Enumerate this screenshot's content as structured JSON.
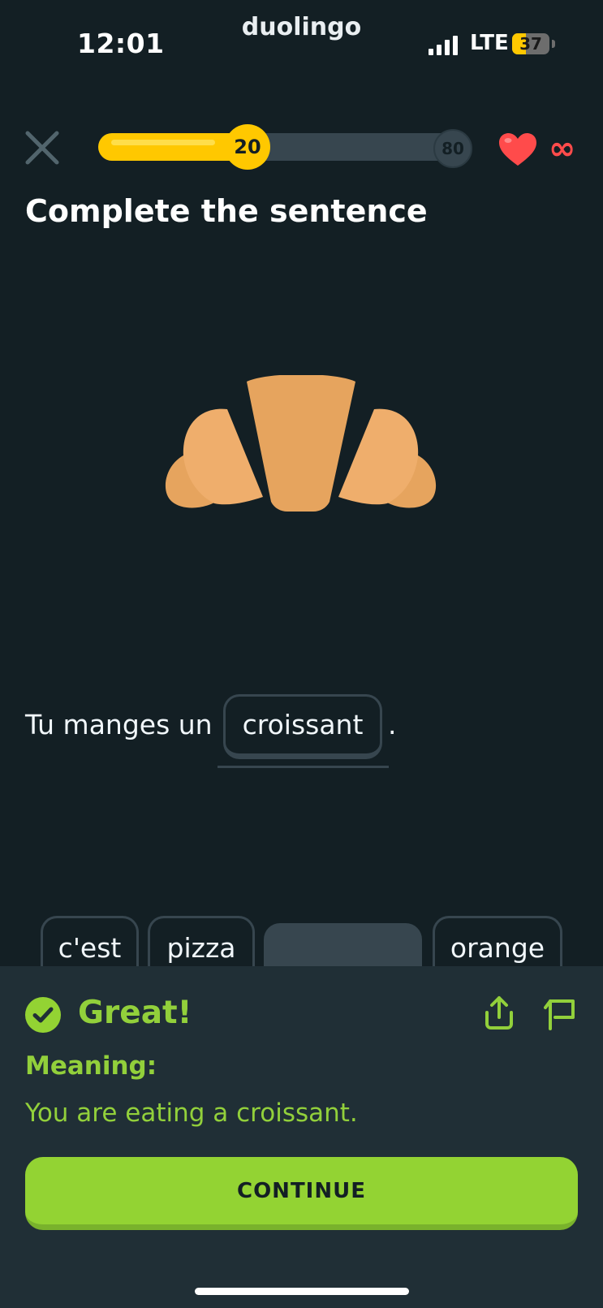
{
  "status_bar": {
    "time": "12:01",
    "brand": "duolingo",
    "network": "LTE",
    "battery": "37",
    "battery_level": 0.37
  },
  "lesson": {
    "progress_value": "20",
    "progress_goal": "80",
    "progress_fraction": 0.4,
    "hearts": "∞",
    "title": "Complete the sentence",
    "image_icon": "croissant-icon"
  },
  "sentence": {
    "before": "Tu manges un",
    "answer": "croissant",
    "after": "."
  },
  "word_bank": {
    "words": [
      "c'est",
      "pizza",
      "croissant",
      "orange"
    ],
    "used_index": 2
  },
  "feedback": {
    "status": "Great!",
    "meaning_label": "Meaning:",
    "meaning_text": "You are eating a croissant.",
    "continue_label": "CONTINUE"
  },
  "colors": {
    "background": "#131f24",
    "panel": "#202f36",
    "accent_green": "#93d333",
    "text_green": "#92d03b",
    "progress_yellow": "#ffc800",
    "heart_red": "#ff4b4b",
    "chip_border": "#37464f",
    "croissant_light": "#efae6c",
    "croissant_dark": "#e6a45e"
  },
  "icons": {
    "close": "close-icon",
    "heart": "heart-icon",
    "check": "check-circle-icon",
    "share": "share-icon",
    "flag": "flag-icon"
  }
}
